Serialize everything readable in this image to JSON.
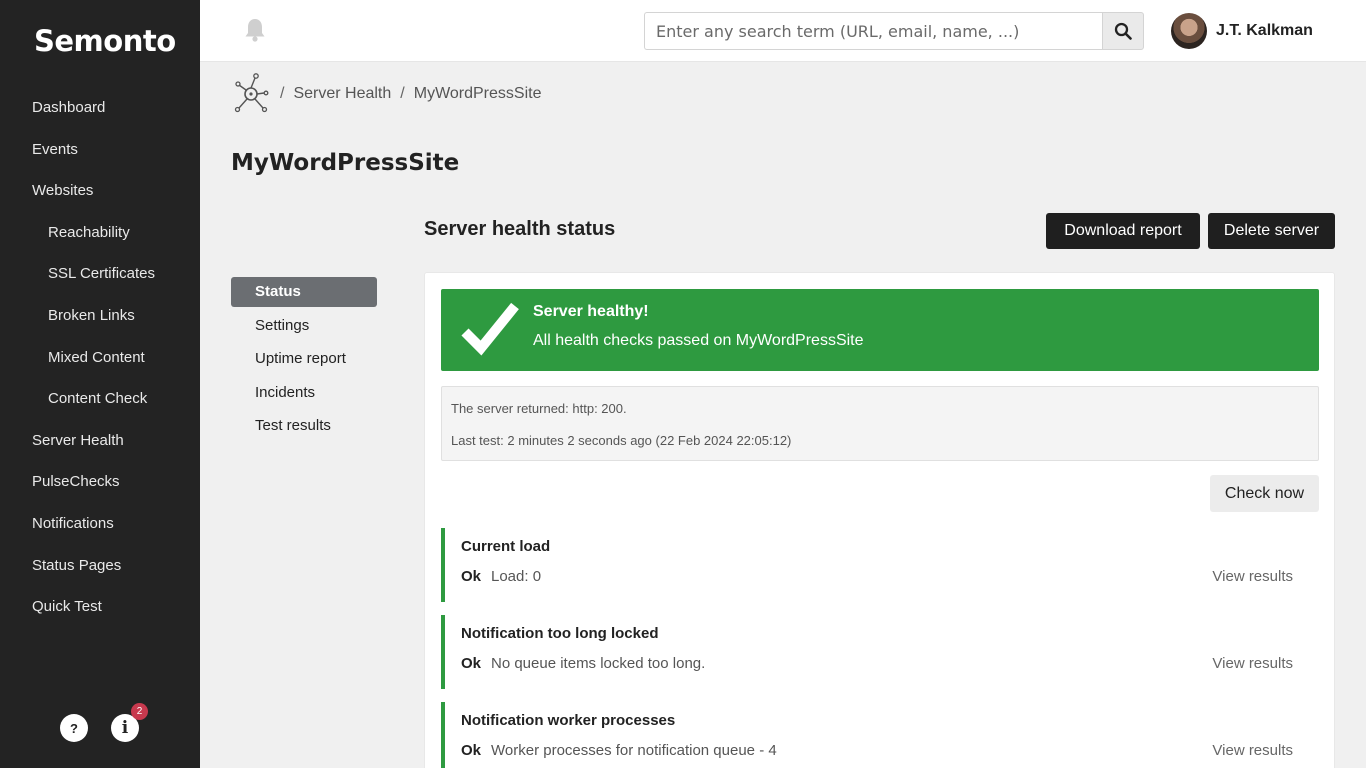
{
  "app": {
    "logo_text": "Semonto"
  },
  "sidebar": {
    "items": [
      {
        "label": "Dashboard",
        "sub": false
      },
      {
        "label": "Events",
        "sub": false
      },
      {
        "label": "Websites",
        "sub": false
      },
      {
        "label": "Reachability",
        "sub": true
      },
      {
        "label": "SSL Certificates",
        "sub": true
      },
      {
        "label": "Broken Links",
        "sub": true
      },
      {
        "label": "Mixed Content",
        "sub": true
      },
      {
        "label": "Content Check",
        "sub": true
      },
      {
        "label": "Server Health",
        "sub": false
      },
      {
        "label": "PulseChecks",
        "sub": false
      },
      {
        "label": "Notifications",
        "sub": false
      },
      {
        "label": "Status Pages",
        "sub": false
      },
      {
        "label": "Quick Test",
        "sub": false
      }
    ],
    "help_label": "?",
    "info_label": "i",
    "info_badge": "2"
  },
  "topbar": {
    "search_placeholder": "Enter any search term (URL, email, name, ...)",
    "user_name": "J.T. Kalkman"
  },
  "breadcrumb": {
    "items": [
      "Server Health",
      "MyWordPressSite"
    ],
    "separator": "/"
  },
  "page": {
    "title": "MyWordPressSite"
  },
  "subnav": {
    "items": [
      {
        "label": "Status",
        "active": true
      },
      {
        "label": "Settings",
        "active": false
      },
      {
        "label": "Uptime report",
        "active": false
      },
      {
        "label": "Incidents",
        "active": false
      },
      {
        "label": "Test results",
        "active": false
      }
    ]
  },
  "main": {
    "section_title": "Server health status",
    "download_label": "Download report",
    "delete_label": "Delete server",
    "alert": {
      "title": "Server healthy!",
      "text": "All health checks passed on MyWordPressSite",
      "color": "#2e9a40"
    },
    "info": {
      "line1": "The server returned: http: 200.",
      "line2": "Last test: 2 minutes 2 seconds ago (22 Feb 2024 22:05:12)"
    },
    "check_now_label": "Check now",
    "checks": [
      {
        "name": "Current load",
        "status": "Ok",
        "description": "Load: 0",
        "link": "View results"
      },
      {
        "name": "Notification too long locked",
        "status": "Ok",
        "description": "No queue items locked too long.",
        "link": "View results"
      },
      {
        "name": "Notification worker processes",
        "status": "Ok",
        "description": "Worker processes for notification queue - 4",
        "link": "View results"
      }
    ]
  }
}
